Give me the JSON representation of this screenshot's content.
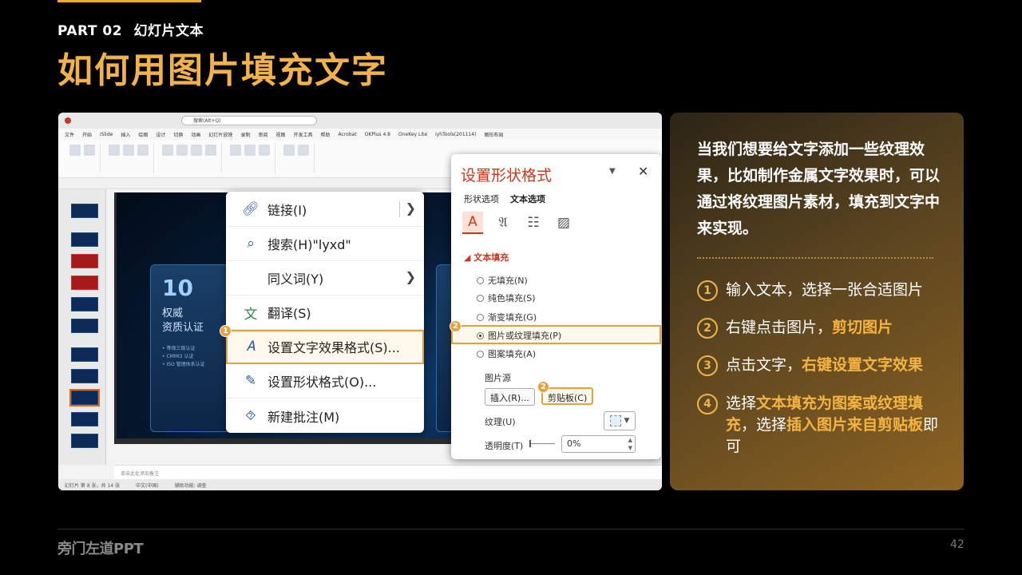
{
  "header": {
    "part_num": "PART 02",
    "part_name": "幻灯片文本",
    "title": "如何用图片填充文字"
  },
  "ppt": {
    "search_placeholder": "搜索(Alt+Q)",
    "menu_items": [
      "文件",
      "开始",
      "iSlide",
      "插入",
      "绘图",
      "设计",
      "切换",
      "动画",
      "幻灯片放映",
      "录制",
      "审阅",
      "视图",
      "开发工具",
      "帮助",
      "Acrobat",
      "OKPlus 4.8",
      "OneKey Lite",
      "iyhTools(201114)",
      "图形布局"
    ],
    "notes_placeholder": "单击此处添加备注",
    "status_left": "幻灯片 第 8 张，共 14 张",
    "status_lang": "中文(中国)",
    "status_access": "辅助功能: 调查",
    "slide": {
      "card1_big": "10",
      "card1_line1": "权威",
      "card1_line2": "资质认证",
      "card1_bullets": [
        "等保三级认证",
        "CMMI3 认证",
        "ISO 管理体系认证"
      ]
    }
  },
  "context_menu": {
    "items": [
      {
        "icon": "link-icon",
        "label": "链接(I)",
        "has_arrow": true
      },
      {
        "icon": "search-icon",
        "label": "搜索(H)\"lyxd\"",
        "has_arrow": false
      },
      {
        "icon": "",
        "label": "同义词(Y)",
        "has_arrow": true
      },
      {
        "icon": "translate-icon",
        "label": "翻译(S)",
        "has_arrow": false
      },
      {
        "icon": "text-effect-icon",
        "label": "设置文字效果格式(S)...",
        "has_arrow": false
      },
      {
        "icon": "shape-format-icon",
        "label": "设置形状格式(O)...",
        "has_arrow": false
      },
      {
        "icon": "comment-icon",
        "label": "新建批注(M)",
        "has_arrow": false
      }
    ]
  },
  "format_pane": {
    "title": "设置形状格式",
    "tab_shape": "形状选项",
    "tab_text": "文本选项",
    "section": "文本填充",
    "options": [
      "无填充(N)",
      "纯色填充(S)",
      "渐变填充(G)",
      "图片或纹理填充(P)",
      "图案填充(A)"
    ],
    "selected_option_index": 3,
    "source_label": "图片源",
    "insert_btn": "插入(R)...",
    "clipboard_btn": "剪贴板(C)",
    "texture_label": "纹理(U)",
    "transparency_label": "透明度(T)",
    "transparency_value": "0%"
  },
  "badges": {
    "b1": "1",
    "b2a": "2",
    "b2b": "2"
  },
  "info": {
    "intro": "当我们想要给文字添加一些纹理效果，比如制作金属文字效果时，可以通过将纹理图片素材，填充到文字中来实现。",
    "steps": [
      {
        "num": "1",
        "parts": [
          {
            "t": "输入文本，选择一张合适图片",
            "hi": false
          }
        ]
      },
      {
        "num": "2",
        "parts": [
          {
            "t": "右键点击图片，",
            "hi": false
          },
          {
            "t": "剪切图片",
            "hi": true
          }
        ]
      },
      {
        "num": "3",
        "parts": [
          {
            "t": "点击文字，",
            "hi": false
          },
          {
            "t": "右键设置文字效果",
            "hi": true
          }
        ]
      },
      {
        "num": "4",
        "parts": [
          {
            "t": "选择",
            "hi": false
          },
          {
            "t": "文本填充为图案或纹理填充",
            "hi": true
          },
          {
            "t": "，选择",
            "hi": false
          },
          {
            "t": "插入图片来自剪贴板",
            "hi": true
          },
          {
            "t": "即可",
            "hi": false
          }
        ]
      }
    ]
  },
  "footer": {
    "brand": "旁门左道PPT",
    "page": "42"
  },
  "colors": {
    "accent": "#f2b24a",
    "highlight_outline": "#e8a03a",
    "pane_red": "#c8391b"
  }
}
